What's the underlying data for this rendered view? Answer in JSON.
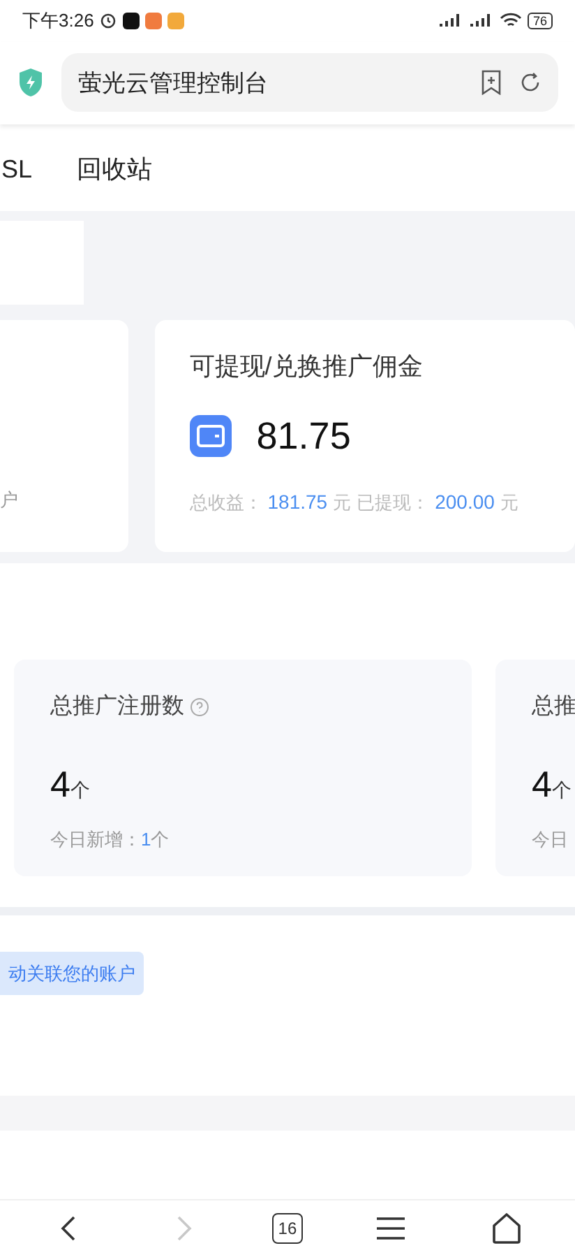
{
  "status_bar": {
    "time": "下午3:26",
    "battery": "76"
  },
  "address_bar": {
    "title": "萤光云管理控制台"
  },
  "tabs": [
    {
      "label": "SL",
      "selected": false
    },
    {
      "label": "回收站",
      "selected": false
    }
  ],
  "balance_cards": [
    {
      "kind": "partial",
      "caption": "户"
    },
    {
      "kind": "full",
      "title": "可提现/兑换推广佣金",
      "amount": "81.75",
      "total_label": "总收益：",
      "total_value": "181.75",
      "unit_1": "元",
      "withdrawn_label": "已提现：",
      "withdrawn_value": "200.00",
      "unit_2": "元"
    }
  ],
  "stat_cards": [
    {
      "title": "总推广注册数",
      "count": "4",
      "unit": "个",
      "today_label": "今日新增：",
      "today_value": "1",
      "today_unit": "个",
      "help": true
    },
    {
      "title": "总推",
      "count": "4",
      "unit": "个",
      "today_label": "今日"
    }
  ],
  "notice": "动关联您的账户",
  "nav": [
    {
      "kind": "back",
      "disabled": false
    },
    {
      "kind": "forward",
      "disabled": true
    },
    {
      "kind": "tabs",
      "label": "16",
      "disabled": false
    },
    {
      "kind": "menu",
      "disabled": false
    },
    {
      "kind": "home",
      "disabled": false
    }
  ]
}
